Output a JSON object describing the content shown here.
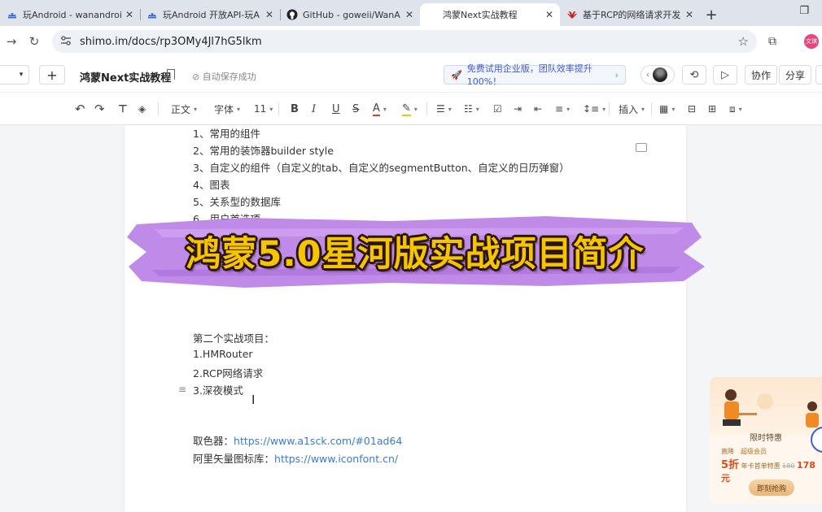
{
  "tabs": [
    {
      "title": "玩Android - wanandroi",
      "icon": "android-icon",
      "active": false
    },
    {
      "title": "玩Android 开放API-玩A",
      "icon": "android-icon",
      "active": false
    },
    {
      "title": "GitHub - goweii/WanA",
      "icon": "github-icon",
      "active": false
    },
    {
      "title": "鸿蒙Next实战教程",
      "icon": "blank-icon",
      "active": true
    },
    {
      "title": "基于RCP的网络请求开发",
      "icon": "huawei-icon",
      "active": false
    }
  ],
  "address": {
    "url": "shimo.im/docs/rp3OMy4Jl7hG5lkm"
  },
  "header": {
    "doc_title": "鸿蒙Next实战教程",
    "save_status": "自动保存成功",
    "promo": "免费试用企业版，团队效率提升100%！",
    "collab": "协作",
    "share": "分享",
    "profile_initials": "文琪"
  },
  "toolbar": {
    "para_style": "正文",
    "font": "字体",
    "font_size": "11",
    "insert": "插入"
  },
  "doc": {
    "lines_top": [
      "1、常用的组件",
      "2、常用的装饰器builder style",
      "3、自定义的组件（自定义的tab、自定义的segmentButton、自定义的日历弹窗）",
      "4、图表",
      "5、关系型的数据库",
      "6、用户首选项..."
    ],
    "banner": "鸿蒙5.0星河版实战项目简介",
    "lines_mid": [
      "第二个实战项目：",
      "1.HMRouter",
      "2.RCP网络请求",
      "3.深夜模式"
    ],
    "color_picker_label": "取色器：",
    "color_picker_link": "https://www.a1sck.com/#01ad64",
    "iconfont_label": "阿里矢量图标库：",
    "iconfont_link": "https://www.iconfont.cn/"
  },
  "ad": {
    "title": "限时特惠",
    "direct_drop": "直降",
    "discount": "5折",
    "member": "超级会员",
    "first_year": "年卡首单特惠",
    "old_price": "180",
    "price": "178元",
    "cta": "即刻抢购"
  },
  "colors": {
    "banner_text": "#f6c500",
    "banner_brush": "#c08ae8",
    "link": "#3a7bd5",
    "promo_text": "#3d5bd9"
  }
}
